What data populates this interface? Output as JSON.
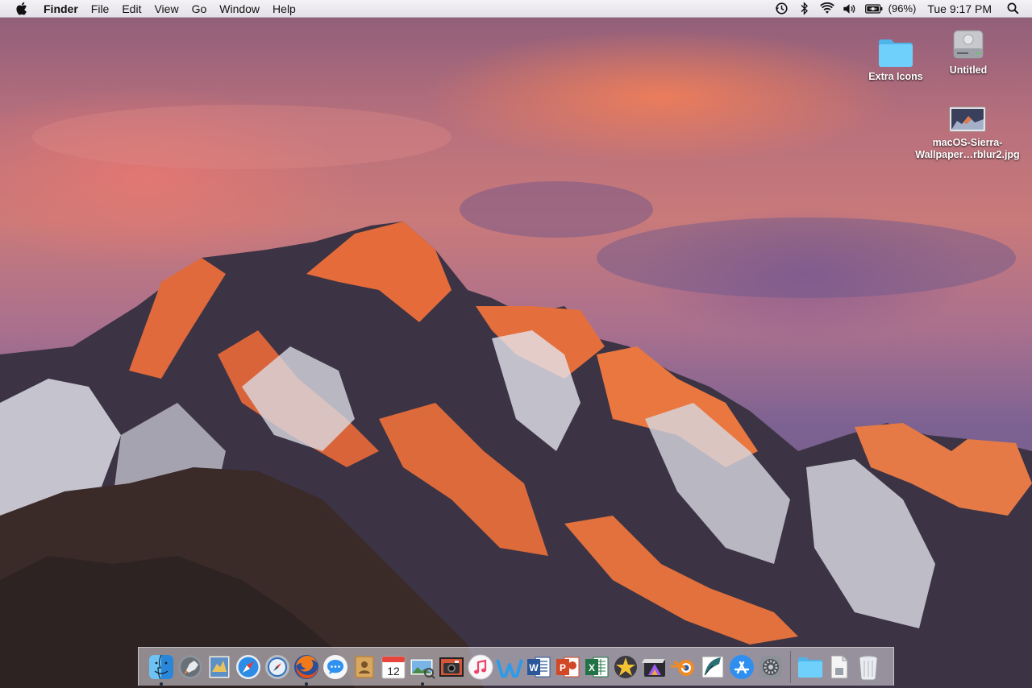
{
  "menubar": {
    "apple_icon": "apple-logo",
    "app_name": "Finder",
    "menus": [
      "File",
      "Edit",
      "View",
      "Go",
      "Window",
      "Help"
    ],
    "status_icons": [
      "time-machine-icon",
      "bluetooth-icon",
      "wifi-icon",
      "volume-icon",
      "battery-icon"
    ],
    "battery_percent": "(96%)",
    "clock": "Tue 9:17 PM",
    "spotlight_icon": "search-icon"
  },
  "desktop": {
    "icons": [
      {
        "label": "Extra Icons",
        "type": "folder-icon"
      },
      {
        "label": "Untitled",
        "type": "hard-drive-icon"
      },
      {
        "label_line1": "macOS-Sierra-",
        "label_line2": "Wallpaper…rblur2.jpg",
        "type": "image-file-icon"
      }
    ]
  },
  "dock": {
    "apps": [
      {
        "name": "finder-icon",
        "running": true
      },
      {
        "name": "launchpad-icon",
        "running": false
      },
      {
        "name": "preview-bird-icon",
        "running": false
      },
      {
        "name": "safari-icon",
        "running": false
      },
      {
        "name": "compass-icon",
        "running": false
      },
      {
        "name": "firefox-icon",
        "running": true
      },
      {
        "name": "messages-icon",
        "running": false
      },
      {
        "name": "contacts-icon",
        "running": false
      },
      {
        "name": "calendar-icon",
        "running": false,
        "badge": "12"
      },
      {
        "name": "preview-icon",
        "running": true
      },
      {
        "name": "photo-booth-icon",
        "running": false
      },
      {
        "name": "itunes-icon",
        "running": false
      },
      {
        "name": "wunderlist-icon",
        "running": false
      },
      {
        "name": "word-icon",
        "running": false
      },
      {
        "name": "powerpoint-icon",
        "running": false
      },
      {
        "name": "excel-icon",
        "running": false
      },
      {
        "name": "imovie-star-icon",
        "running": false
      },
      {
        "name": "final-cut-icon",
        "running": false
      },
      {
        "name": "blender-icon",
        "running": false
      },
      {
        "name": "quill-icon",
        "running": false
      },
      {
        "name": "app-store-icon",
        "running": false
      },
      {
        "name": "system-preferences-icon",
        "running": false
      }
    ],
    "extras": [
      "downloads-folder-icon",
      "document-icon",
      "trash-icon"
    ],
    "colors": {
      "word": "#2b579a",
      "powerpoint": "#d24726",
      "excel": "#217346",
      "folder": "#5ec8f5"
    }
  }
}
